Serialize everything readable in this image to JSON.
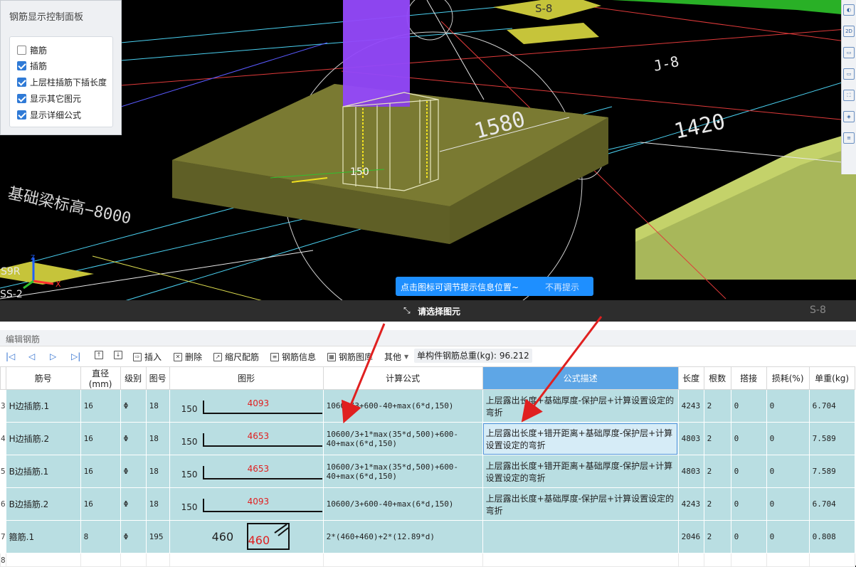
{
  "control_panel": {
    "title": "钢筋显示控制面板",
    "options": [
      {
        "label": "箍筋",
        "checked": false
      },
      {
        "label": "插筋",
        "checked": true
      },
      {
        "label": "上层柱插筋下插长度",
        "checked": true
      },
      {
        "label": "显示其它图元",
        "checked": true
      },
      {
        "label": "显示详细公式",
        "checked": true
      }
    ]
  },
  "viewport": {
    "labels": {
      "s8_top": "S-8",
      "j8": "J-8",
      "dim_1420": "1420",
      "dim_1580": "1580",
      "dim_150": "150",
      "left_text": "基础梁标高−8000",
      "s9r": "S9R",
      "ss2": "SS-2",
      "s8_bottom": "S-8",
      "axis_z": "Z",
      "axis_x": "X"
    },
    "tip": {
      "message": "点击图标可调节提示信息位置~",
      "dismiss": "不再提示"
    },
    "select_hint": "请选择图元"
  },
  "editor": {
    "title": "编辑钢筋",
    "toolbar": {
      "insert": "插入",
      "delete": "删除",
      "scale_rebar": "缩尺配筋",
      "rebar_info": "钢筋信息",
      "rebar_library": "钢筋图库",
      "other": "其他",
      "weight_label": "单构件钢筋总重(kg):",
      "weight_value": "96.212"
    },
    "columns": [
      "筋号",
      "直径(mm)",
      "级别",
      "图号",
      "图形",
      "计算公式",
      "公式描述",
      "长度",
      "根数",
      "搭接",
      "损耗(%)",
      "单重(kg)"
    ],
    "rows": [
      {
        "rn": "3",
        "name": "H边插筋.1",
        "dia": "16",
        "grade": "Φ",
        "fig": "18",
        "shape_left": "150",
        "shape_len": "4093",
        "formula": "10600/3+600-40+max(6*d,150)",
        "desc": "上层露出长度+基础厚度-保护层+计算设置设定的弯折",
        "length": "4243",
        "count": "2",
        "lap": "0",
        "loss": "0",
        "unit_weight": "6.704"
      },
      {
        "rn": "4",
        "name": "H边插筋.2",
        "dia": "16",
        "grade": "Φ",
        "fig": "18",
        "shape_left": "150",
        "shape_len": "4653",
        "formula": "10600/3+1*max(35*d,500)+600-40+max(6*d,150)",
        "desc": "上层露出长度+错开距离+基础厚度-保护层+计算设置设定的弯折",
        "length": "4803",
        "count": "2",
        "lap": "0",
        "loss": "0",
        "unit_weight": "7.589"
      },
      {
        "rn": "5",
        "name": "B边插筋.1",
        "dia": "16",
        "grade": "Φ",
        "fig": "18",
        "shape_left": "150",
        "shape_len": "4653",
        "formula": "10600/3+1*max(35*d,500)+600-40+max(6*d,150)",
        "desc": "上层露出长度+错开距离+基础厚度-保护层+计算设置设定的弯折",
        "length": "4803",
        "count": "2",
        "lap": "0",
        "loss": "0",
        "unit_weight": "7.589"
      },
      {
        "rn": "6",
        "name": "B边插筋.2",
        "dia": "16",
        "grade": "Φ",
        "fig": "18",
        "shape_left": "150",
        "shape_len": "4093",
        "formula": "10600/3+600-40+max(6*d,150)",
        "desc": "上层露出长度+基础厚度-保护层+计算设置设定的弯折",
        "length": "4243",
        "count": "2",
        "lap": "0",
        "loss": "0",
        "unit_weight": "6.704"
      },
      {
        "rn": "7",
        "name": "箍筋.1",
        "dia": "8",
        "grade": "Φ",
        "fig": "195",
        "stirrup_left": "460",
        "stirrup_right": "460",
        "formula": "2*(460+460)+2*(12.89*d)",
        "desc": "",
        "length": "2046",
        "count": "2",
        "lap": "0",
        "loss": "0",
        "unit_weight": "0.808"
      }
    ],
    "empty_row_rn": "8"
  },
  "colors": {
    "accent": "#1e8fff",
    "row_bg": "#b9dee2",
    "header_highlight": "#5ea6e6",
    "arrow": "#e02020"
  }
}
